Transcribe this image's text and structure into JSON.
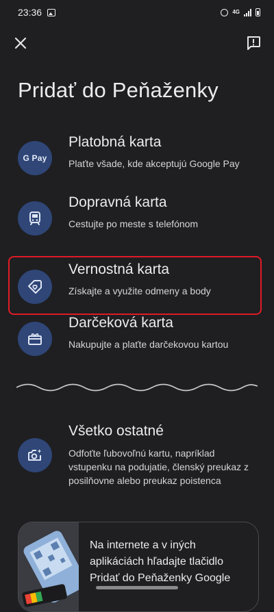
{
  "status_bar": {
    "time": "23:36",
    "network": "4G"
  },
  "page": {
    "title": "Pridať do Peňaženky"
  },
  "options": [
    {
      "title": "Platobná karta",
      "subtitle": "Plaťte všade, kde akceptujú Google Pay",
      "icon": "google-pay-icon",
      "badge": "G Pay"
    },
    {
      "title": "Dopravná karta",
      "subtitle": "Cestujte po meste s telefónom",
      "icon": "train-icon"
    },
    {
      "title": "Vernostná karta",
      "subtitle": "Získajte a využite odmeny a body",
      "icon": "loyalty-tag-icon",
      "selected": true
    },
    {
      "title": "Darčeková karta",
      "subtitle": "Nakupujte a plaťte darčekovou kartou",
      "icon": "gift-card-icon"
    }
  ],
  "other": {
    "title": "Všetko ostatné",
    "subtitle": "Odfoťte ľubovoľnú kartu, napríklad vstupenku na podujatie, členský preukaz z posilňovne alebo preukaz poistenca",
    "icon": "camera-icon"
  },
  "promo": {
    "text": "Na internete a v iných aplikáciách hľadajte tlačidlo Pridať do Peňaženky Google"
  },
  "colors": {
    "background": "#1f1f22",
    "icon_circle": "#2f4677",
    "highlight": "#e01b24"
  }
}
